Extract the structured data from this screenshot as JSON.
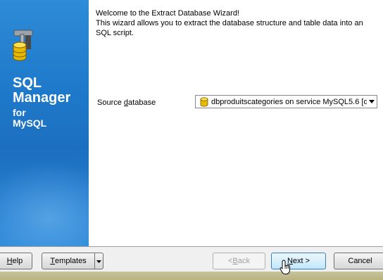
{
  "sidebar": {
    "brand_line1": "SQL",
    "brand_line2": "Manager",
    "brand_line3": "for",
    "brand_line4": "MySQL",
    "logo_icon": "database-tools-icon"
  },
  "wizard": {
    "intro_line1": "Welcome to the Extract Database Wizard!",
    "intro_line2": "This wizard allows you to extract the database structure and table data into an SQL script.",
    "source_label_pre": "Source ",
    "source_label_accel": "d",
    "source_label_post": "atabase",
    "source_value": "dbproduitscategories on service MySQL5.6 [d",
    "source_icon": "database-icon"
  },
  "footer": {
    "help_accel": "H",
    "help_rest": "elp",
    "templates_accel": "T",
    "templates_rest": "emplates",
    "back_pre": "< ",
    "back_accel": "B",
    "back_rest": "ack",
    "next_accel": "N",
    "next_rest": "ext >",
    "cancel_label": "Cancel"
  },
  "colors": {
    "sidebar": "#1f7acb",
    "focus_border": "#3c7fb1"
  }
}
